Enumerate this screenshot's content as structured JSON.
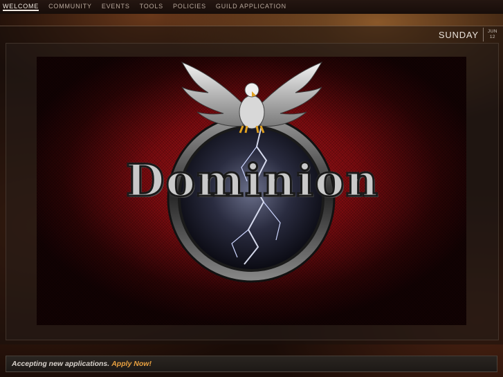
{
  "nav": {
    "items": [
      {
        "label": "WELCOME",
        "active": true
      },
      {
        "label": "COMMUNITY"
      },
      {
        "label": "EVENTS"
      },
      {
        "label": "TOOLS"
      },
      {
        "label": "POLICIES"
      },
      {
        "label": "GUILD APPLICATION"
      }
    ]
  },
  "date": {
    "day": "SUNDAY",
    "month": "JUN",
    "day_num": "12"
  },
  "banner": {
    "brand": "Dominion",
    "emblem_icon": "eagle-emblem-icon"
  },
  "footer": {
    "text": "Accepting new applications.",
    "link": "Apply Now!"
  },
  "colors": {
    "accent": "#e8a040",
    "banner_red": "#b0161b"
  }
}
